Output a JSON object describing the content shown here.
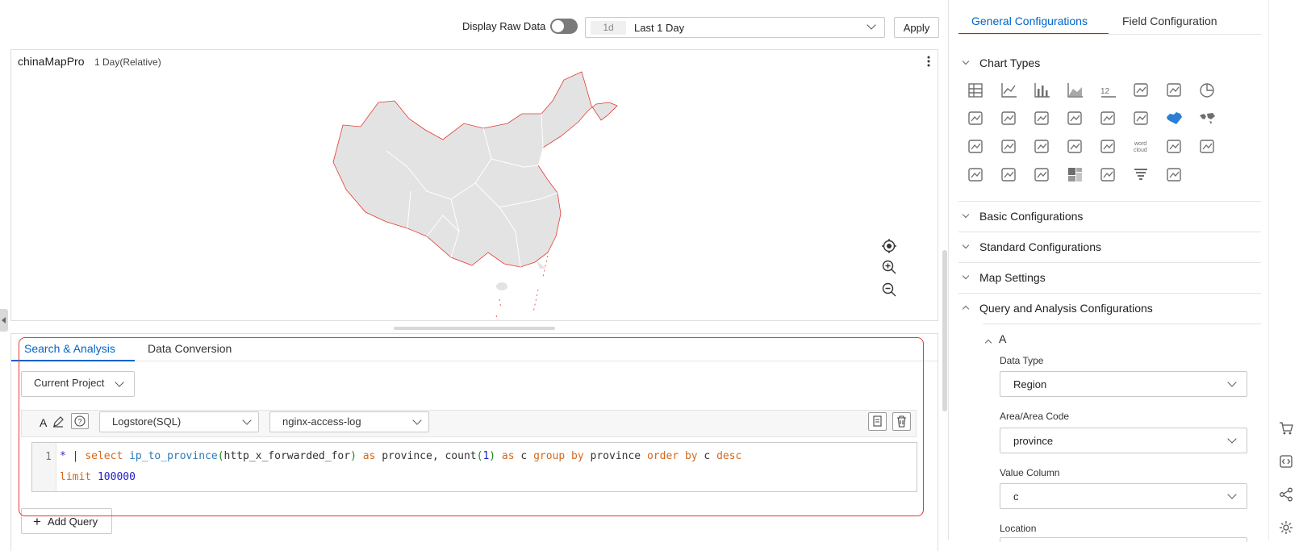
{
  "toolbar": {
    "raw_data_label": "Display Raw Data",
    "time_tag": "1d",
    "time_value": "Last 1 Day",
    "apply_label": "Apply"
  },
  "chart": {
    "title": "chinaMapPro",
    "time_range": "1 Day(Relative)"
  },
  "query": {
    "tabs": [
      "Search & Analysis",
      "Data Conversion"
    ],
    "project_select": "Current Project",
    "logstore_type": "Logstore(SQL)",
    "logstore_name": "nginx-access-log",
    "line_number": "1",
    "code_line1": "* | select ip_to_province(http_x_forwarded_for) as province, count(1) as c group by province order by c desc",
    "code_line2": "limit 100000",
    "add_query_label": "Add Query"
  },
  "config": {
    "tabs": [
      "General Configurations",
      "Field Configuration"
    ],
    "sections": {
      "chart_types": "Chart Types",
      "basic": "Basic Configurations",
      "standard": "Standard Configurations",
      "map": "Map Settings",
      "query_analysis": "Query and Analysis Configurations"
    },
    "query_name": "A",
    "fields": {
      "data_type_label": "Data Type",
      "data_type_value": "Region",
      "area_label": "Area/Area Code",
      "area_value": "province",
      "value_col_label": "Value Column",
      "value_col_value": "c",
      "location_label": "Location"
    }
  },
  "colors": {
    "accent": "#0064c8",
    "highlight_border": "#e53935",
    "map_fill": "#e3e3e3"
  }
}
